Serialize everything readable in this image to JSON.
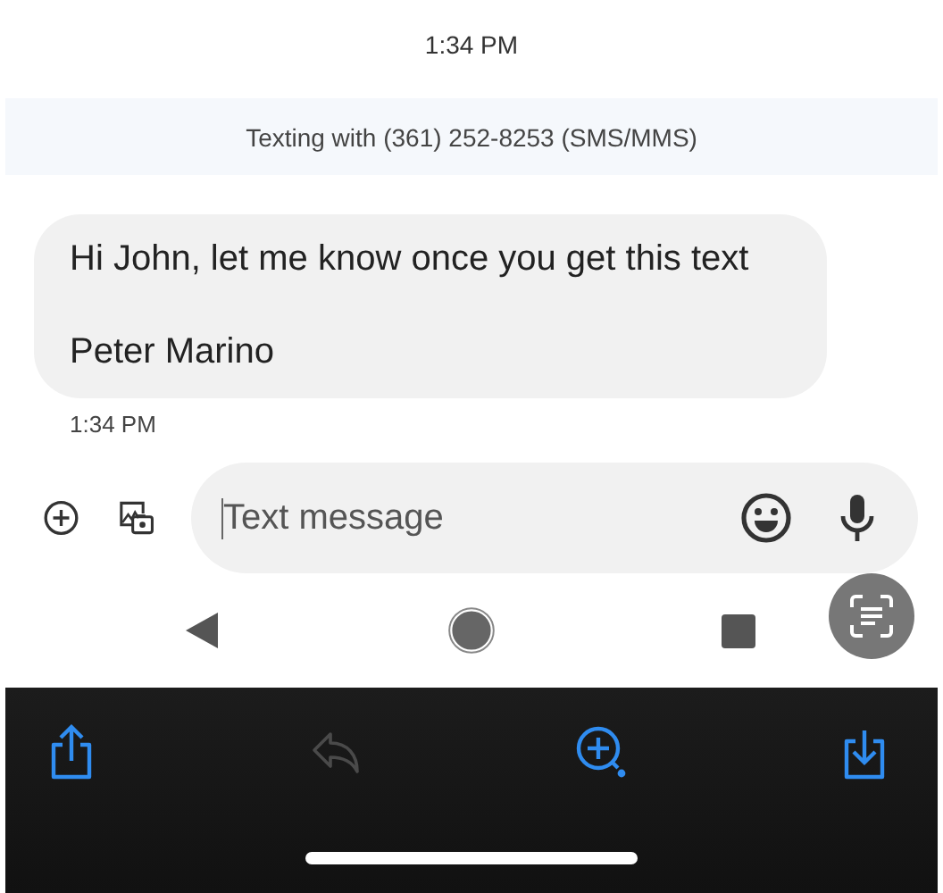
{
  "header": {
    "time": "1:34 PM"
  },
  "banner": {
    "text": "Texting with (361) 252-8253 (SMS/MMS)"
  },
  "messages": [
    {
      "text": "Hi John, let me know once you get this text\n\nPeter Marino",
      "time": "1:34 PM"
    }
  ],
  "compose": {
    "placeholder": "Text message"
  },
  "toolbar": [
    {
      "kind": "share",
      "disabled": false
    },
    {
      "kind": "reply",
      "disabled": true
    },
    {
      "kind": "zoom",
      "disabled": false
    },
    {
      "kind": "download",
      "disabled": false
    }
  ]
}
